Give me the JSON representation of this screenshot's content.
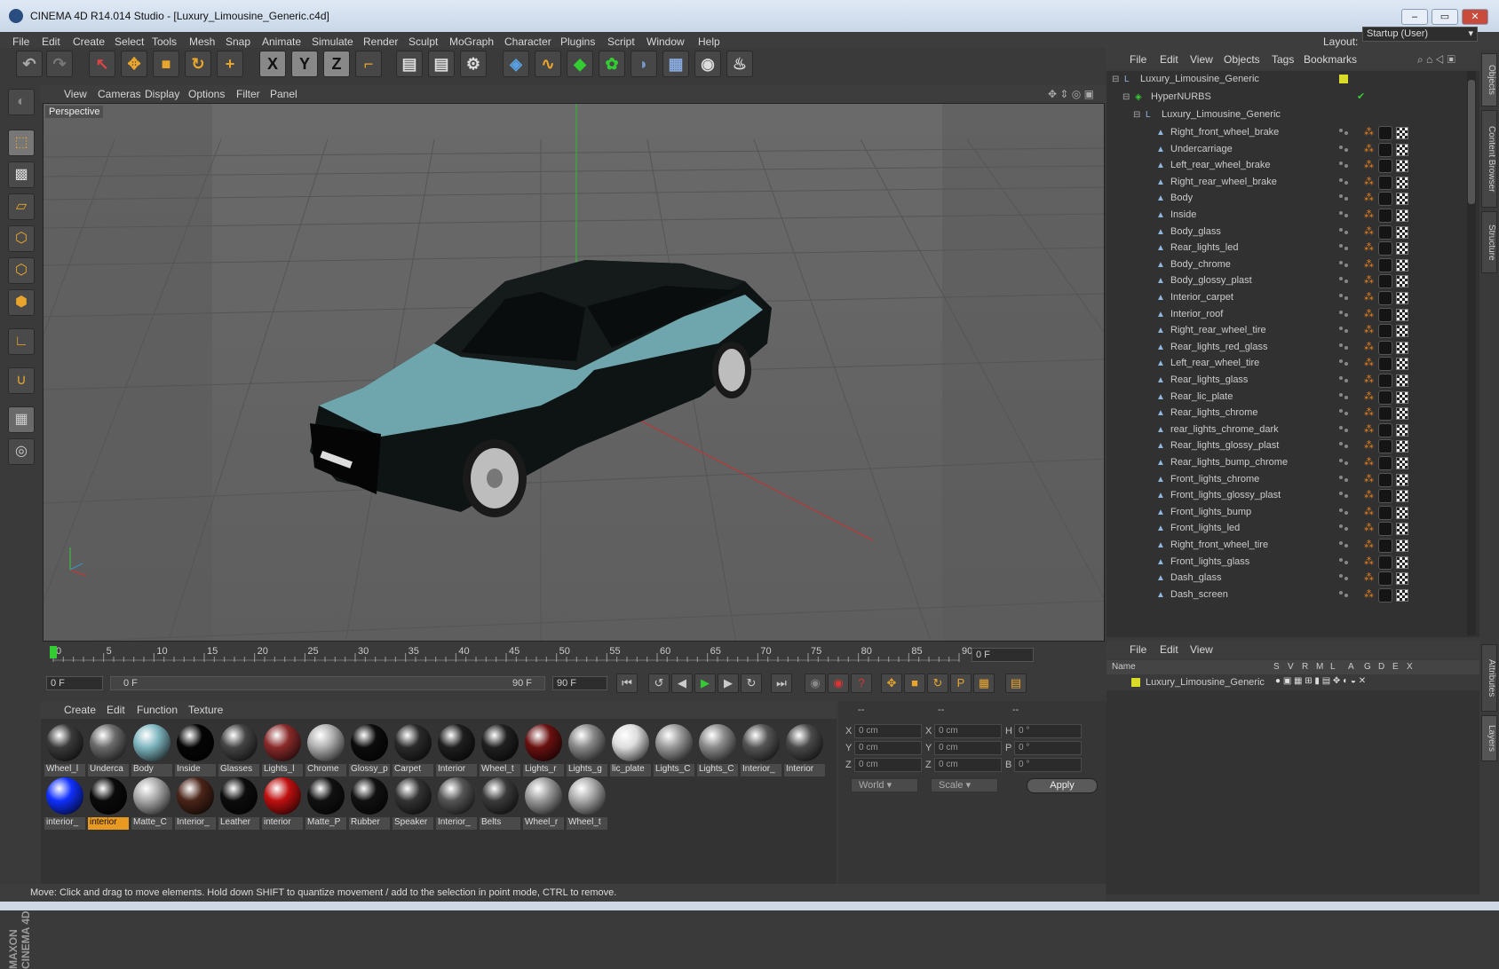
{
  "window": {
    "title": "CINEMA 4D R14.014 Studio - [Luxury_Limousine_Generic.c4d]"
  },
  "menu": [
    "File",
    "Edit",
    "Create",
    "Select",
    "Tools",
    "Mesh",
    "Snap",
    "Animate",
    "Simulate",
    "Render",
    "Sculpt",
    "MoGraph",
    "Character",
    "Plugins",
    "Script",
    "Window",
    "Help"
  ],
  "layout": {
    "label": "Layout:",
    "value": "Startup (User)"
  },
  "viewport": {
    "menu": [
      "View",
      "Cameras",
      "Display",
      "Options",
      "Filter",
      "Panel"
    ],
    "label": "Perspective"
  },
  "timeline": {
    "ticks": [
      "0",
      "5",
      "10",
      "15",
      "20",
      "25",
      "30",
      "35",
      "40",
      "45",
      "50",
      "55",
      "60",
      "65",
      "70",
      "75",
      "80",
      "85",
      "90"
    ],
    "current_frame": "0 F",
    "start_field": "0 F",
    "range_start": "0 F",
    "range_end": "90 F",
    "end_field": "90 F"
  },
  "materials": {
    "menu": [
      "Create",
      "Edit",
      "Function",
      "Texture"
    ],
    "row1": [
      {
        "label": "Wheel_l",
        "color": "#3a3a3a"
      },
      {
        "label": "Underca",
        "color": "#6a6a6a"
      },
      {
        "label": "Body",
        "color": "#7fb6c0"
      },
      {
        "label": "Inside",
        "color": "#050505"
      },
      {
        "label": "Glasses",
        "color": "#444444"
      },
      {
        "label": "Lights_l",
        "color": "#8a2a2a"
      },
      {
        "label": "Chrome",
        "color": "#b0b0b0"
      },
      {
        "label": "Glossy_p",
        "color": "#0c0c0c"
      },
      {
        "label": "Carpet",
        "color": "#2a2a2a"
      },
      {
        "label": "Interior",
        "color": "#1e1e1e"
      },
      {
        "label": "Wheel_t",
        "color": "#202020"
      },
      {
        "label": "Lights_r",
        "color": "#6a1010"
      },
      {
        "label": "Lights_g",
        "color": "#888888"
      },
      {
        "label": "lic_plate",
        "color": "#dddddd"
      },
      {
        "label": "Lights_C",
        "color": "#999999"
      },
      {
        "label": "Lights_C",
        "color": "#8a8a8a"
      },
      {
        "label": "Interior_",
        "color": "#555555"
      },
      {
        "label": "Interior",
        "color": "#4a4a4a"
      }
    ],
    "row2": [
      {
        "label": "interior_",
        "color": "#1030ff"
      },
      {
        "label": "interior",
        "color": "#0a0a0a",
        "selected": true
      },
      {
        "label": "Matte_C",
        "color": "#aaaaaa"
      },
      {
        "label": "Interior_",
        "color": "#4a2418"
      },
      {
        "label": "Leather",
        "color": "#0c0c0c"
      },
      {
        "label": "interior",
        "color": "#c01010"
      },
      {
        "label": "Matte_P",
        "color": "#111111"
      },
      {
        "label": "Rubber",
        "color": "#111111"
      },
      {
        "label": "Speaker",
        "color": "#333333"
      },
      {
        "label": "Interior_",
        "color": "#555555"
      },
      {
        "label": "Belts",
        "color": "#3a3a3a"
      },
      {
        "label": "Wheel_r",
        "color": "#9a9a9a"
      },
      {
        "label": "Wheel_t",
        "color": "#aaaaaa"
      }
    ]
  },
  "coords": {
    "headers": [
      "--",
      "--",
      "--"
    ],
    "rows": [
      {
        "a": "X",
        "v1": "0 cm",
        "b": "X",
        "v2": "0 cm",
        "c": "H",
        "v3": "0 °"
      },
      {
        "a": "Y",
        "v1": "0 cm",
        "b": "Y",
        "v2": "0 cm",
        "c": "P",
        "v3": "0 °"
      },
      {
        "a": "Z",
        "v1": "0 cm",
        "b": "Z",
        "v2": "0 cm",
        "c": "B",
        "v3": "0 °"
      }
    ],
    "world": "World",
    "scale": "Scale",
    "apply": "Apply"
  },
  "status": "Move: Click and drag to move elements. Hold down SHIFT to quantize movement / add to the selection in point mode, CTRL to remove.",
  "objects": {
    "menu": [
      "File",
      "Edit",
      "View",
      "Objects",
      "Tags",
      "Bookmarks"
    ],
    "root": "Luxury_Limousine_Generic",
    "nurbs": "HyperNURBS",
    "group": "Luxury_Limousine_Generic",
    "items": [
      "Right_front_wheel_brake",
      "Undercarriage",
      "Left_rear_wheel_brake",
      "Right_rear_wheel_brake",
      "Body",
      "Inside",
      "Body_glass",
      "Rear_lights_led",
      "Body_chrome",
      "Body_glossy_plast",
      "Interior_carpet",
      "Interior_roof",
      "Right_rear_wheel_tire",
      "Rear_lights_red_glass",
      "Left_rear_wheel_tire",
      "Rear_lights_glass",
      "Rear_lic_plate",
      "Rear_lights_chrome",
      "rear_lights_chrome_dark",
      "Rear_lights_glossy_plast",
      "Rear_lights_bump_chrome",
      "Front_lights_chrome",
      "Front_lights_glossy_plast",
      "Front_lights_bump",
      "Front_lights_led",
      "Right_front_wheel_tire",
      "Front_lights_glass",
      "Dash_glass",
      "Dash_screen"
    ]
  },
  "layers": {
    "menu": [
      "File",
      "Edit",
      "View"
    ],
    "columns": [
      "Name",
      "S",
      "V",
      "R",
      "M",
      "L",
      "A",
      "G",
      "D",
      "E",
      "X"
    ],
    "row": "Luxury_Limousine_Generic"
  },
  "side_tabs": [
    "Objects",
    "Content Browser",
    "Structure",
    "Attributes",
    "Layers"
  ],
  "brand": "MAXON CINEMA 4D",
  "colors": {
    "accent": "#e89a20",
    "body": "#7fb6c0"
  }
}
